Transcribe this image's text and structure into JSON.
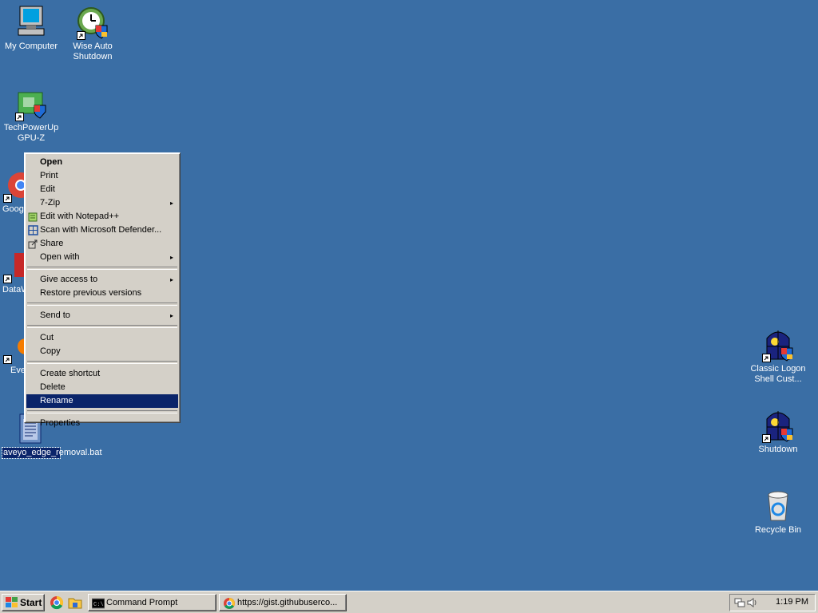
{
  "desktop": {
    "icons_left": [
      {
        "label": "My Computer"
      },
      {
        "label": "Wise Auto Shutdown"
      },
      {
        "label": "TechPowerUp GPU-Z"
      },
      {
        "label": "Googl"
      },
      {
        "label": "DataW"
      },
      {
        "label": "Eve"
      },
      {
        "label": "aveyo_edge_removal.bat"
      }
    ],
    "icons_right": [
      {
        "label": "Classic Logon Shell Cust..."
      },
      {
        "label": "Shutdown"
      },
      {
        "label": "Recycle Bin"
      }
    ]
  },
  "context_menu": {
    "items": [
      {
        "label": "Open",
        "bold": true
      },
      {
        "label": "Print"
      },
      {
        "label": "Edit"
      },
      {
        "label": "7-Zip",
        "submenu": true
      },
      {
        "label": "Edit with Notepad++",
        "icon": "notepadpp-icon"
      },
      {
        "label": "Scan with Microsoft Defender...",
        "icon": "defender-icon"
      },
      {
        "label": "Share",
        "icon": "share-icon"
      },
      {
        "label": "Open with",
        "submenu": true
      },
      {
        "label": "Give access to",
        "submenu": true
      },
      {
        "label": "Restore previous versions"
      },
      {
        "label": "Send to",
        "submenu": true
      },
      {
        "label": "Cut"
      },
      {
        "label": "Copy"
      },
      {
        "label": "Create shortcut"
      },
      {
        "label": "Delete"
      },
      {
        "label": "Rename",
        "highlighted": true
      },
      {
        "label": "Properties"
      }
    ],
    "submenu_arrow": "▸"
  },
  "taskbar": {
    "start_label": "Start",
    "buttons": [
      {
        "label": "Command Prompt",
        "icon": "cmd-icon"
      },
      {
        "label": "https://gist.githubuserco...",
        "icon": "chrome-icon"
      }
    ],
    "clock": "1:19 PM"
  },
  "colors": {
    "desktop": "#3a6ea5",
    "menu_highlight": "#0a246a",
    "face": "#d4d0c8"
  }
}
